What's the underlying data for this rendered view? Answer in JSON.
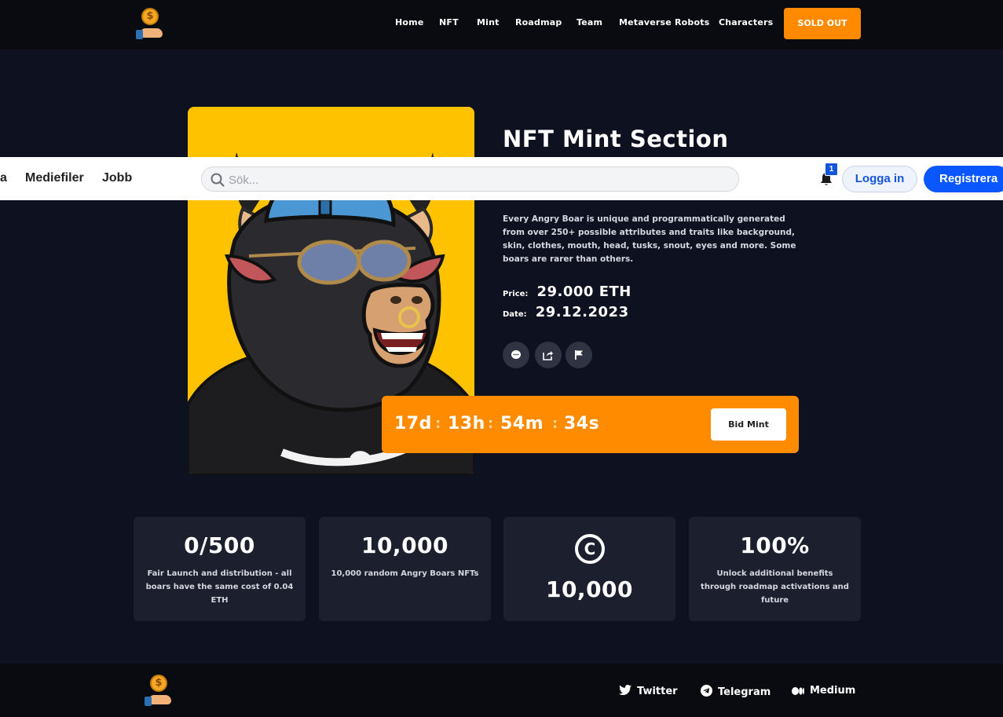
{
  "nav": {
    "links": [
      "Home",
      "NFT",
      "Mint",
      "Roadmap",
      "Team",
      "Metaverse Robots",
      "Characters"
    ],
    "cta": "SOLD OUT"
  },
  "logo": {
    "coin_symbol": "$",
    "icon": "coin-hand-icon"
  },
  "mint": {
    "title": "NFT Mint Section",
    "description": "Every Angry Boar is unique and programmatically generated from over 250+ possible attributes and traits like background, skin, clothes, mouth, head, tusks, snout, eyes and more. Some boars are rarer than others.",
    "price_label": "Price:",
    "price_value": "29.000 ETH",
    "date_label": "Date:",
    "date_value": "29.12.2023",
    "actions": [
      "comment-icon",
      "share-icon",
      "flag-icon"
    ]
  },
  "countdown": {
    "days": "17d",
    "hours": "13h",
    "minutes": "54m",
    "seconds": "34s",
    "separator": ":",
    "button": "Bid Mint"
  },
  "stats": [
    {
      "value": "0/500",
      "desc": "Fair Launch and distribution - all boars have the same cost of 0.04 ETH"
    },
    {
      "value": "10,000",
      "desc": "10,000 random Angry Boars NFTs"
    },
    {
      "icon_symbol": "C",
      "value": "10,000"
    },
    {
      "value": "100%",
      "desc": "Unlock additional benefits through roadmap activations and future"
    }
  ],
  "footer": {
    "links": [
      "Twitter",
      "Telegram",
      "Medium"
    ]
  },
  "overlay": {
    "tab_partial": "a",
    "tabs": [
      "Mediefiler",
      "Jobb"
    ],
    "search_placeholder": "Sök...",
    "notification_count": "1",
    "login": "Logga in",
    "register": "Registrera"
  },
  "colors": {
    "background": "#0e1120",
    "accent": "#ff8c00",
    "card": "#1c1f2d",
    "nft_background": "#ffc200",
    "overlay_primary": "#0a57ff"
  }
}
